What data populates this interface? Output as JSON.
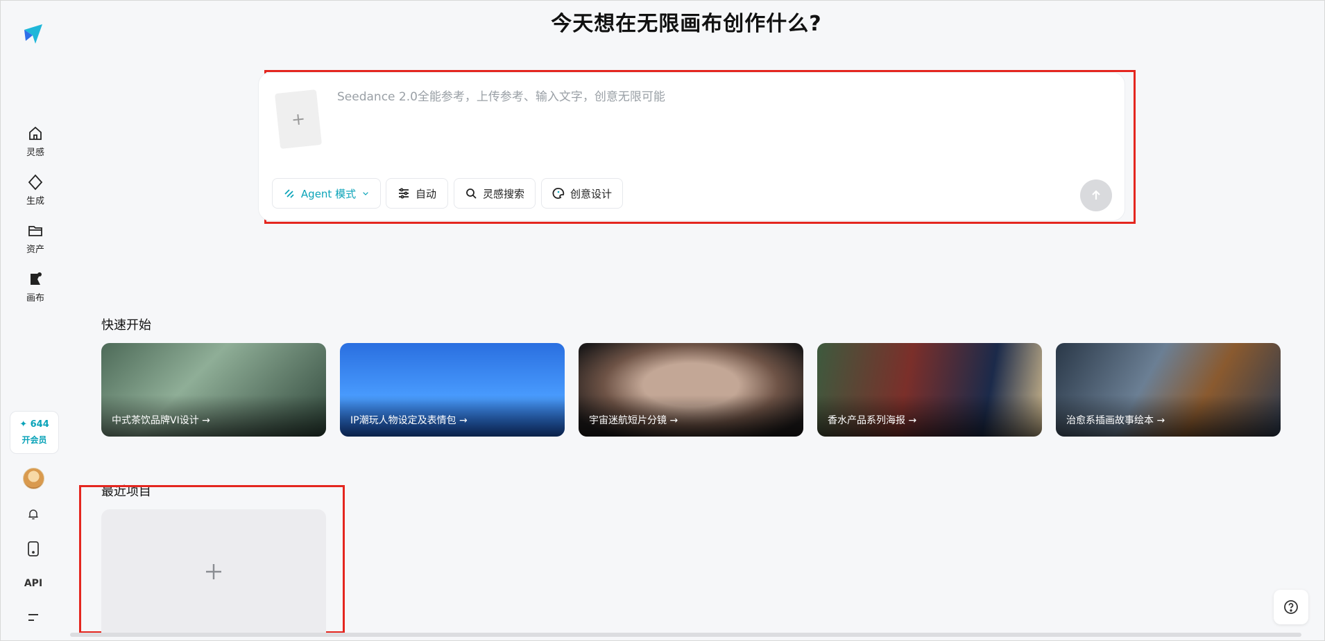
{
  "page": {
    "title": "今天想在无限画布创作什么?"
  },
  "sidebar": {
    "items": [
      {
        "label": "灵感",
        "icon": "home-icon"
      },
      {
        "label": "生成",
        "icon": "diamond-icon"
      },
      {
        "label": "资产",
        "icon": "folder-icon"
      },
      {
        "label": "画布",
        "icon": "canvas-icon"
      }
    ],
    "credits": {
      "count": "✦ 644",
      "vip_label": "开会员"
    },
    "api_label": "API"
  },
  "composer": {
    "placeholder": "Seedance 2.0全能参考，上传参考、输入文字，创意无限可能",
    "upload_glyph": "+",
    "chips": {
      "agent": "Agent 模式",
      "auto": "自动",
      "search": "灵感搜索",
      "design": "创意设计"
    }
  },
  "quick_start": {
    "title": "快速开始",
    "cards": [
      {
        "caption": "中式茶饮品牌VI设计 →"
      },
      {
        "caption": "IP潮玩人物设定及表情包 →"
      },
      {
        "caption": "宇宙迷航短片分镜 →"
      },
      {
        "caption": "香水产品系列海报 →"
      },
      {
        "caption": "治愈系插画故事绘本 →"
      }
    ]
  },
  "recent": {
    "title": "最近项目"
  },
  "colors": {
    "accent": "#0aa3b8",
    "highlight": "#e4261f",
    "background": "#f6f7f9"
  }
}
